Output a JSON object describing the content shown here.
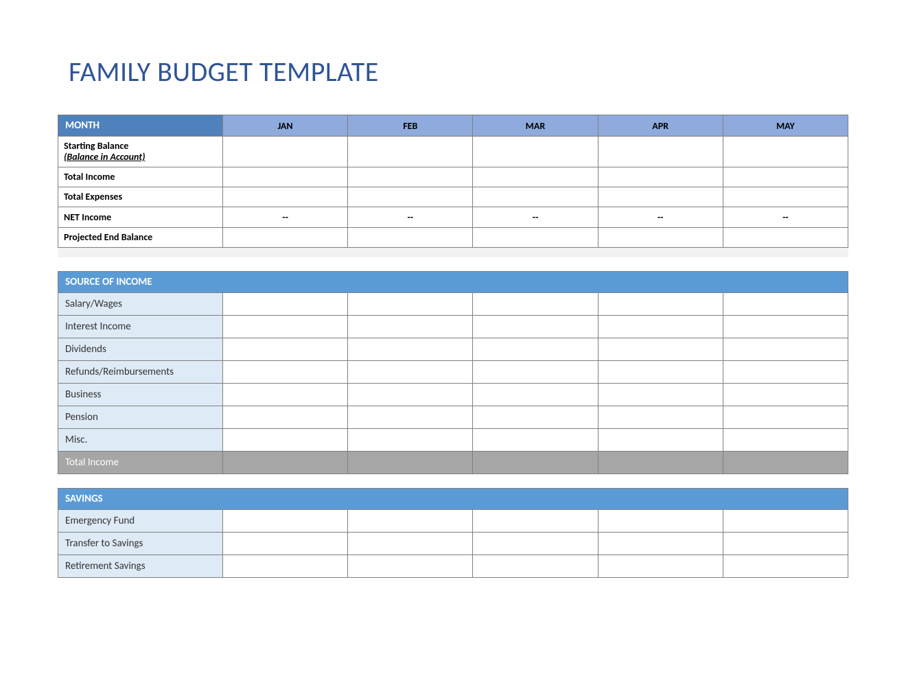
{
  "title": "FAMILY BUDGET TEMPLATE",
  "months": [
    "JAN",
    "FEB",
    "MAR",
    "APR",
    "MAY"
  ],
  "summary": {
    "month_label": "MONTH",
    "rows": [
      {
        "label": "Starting Balance",
        "sublabel": "(Balance in Account)",
        "values": [
          "",
          "",
          "",
          "",
          ""
        ]
      },
      {
        "label": "Total Income",
        "values": [
          "",
          "",
          "",
          "",
          ""
        ]
      },
      {
        "label": "Total Expenses",
        "values": [
          "",
          "",
          "",
          "",
          ""
        ]
      },
      {
        "label": "NET Income",
        "values": [
          "--",
          "--",
          "--",
          "--",
          "--"
        ]
      },
      {
        "label": "Projected End Balance",
        "values": [
          "",
          "",
          "",
          "",
          ""
        ]
      }
    ]
  },
  "income": {
    "header": "SOURCE OF INCOME",
    "rows": [
      {
        "label": "Salary/Wages",
        "values": [
          "",
          "",
          "",
          "",
          ""
        ]
      },
      {
        "label": "Interest Income",
        "values": [
          "",
          "",
          "",
          "",
          ""
        ]
      },
      {
        "label": "Dividends",
        "values": [
          "",
          "",
          "",
          "",
          ""
        ]
      },
      {
        "label": "Refunds/Reimbursements",
        "values": [
          "",
          "",
          "",
          "",
          ""
        ]
      },
      {
        "label": "Business",
        "values": [
          "",
          "",
          "",
          "",
          ""
        ]
      },
      {
        "label": "Pension",
        "values": [
          "",
          "",
          "",
          "",
          ""
        ]
      },
      {
        "label": "Misc.",
        "values": [
          "",
          "",
          "",
          "",
          ""
        ]
      }
    ],
    "total_label": "Total Income",
    "total_values": [
      "",
      "",
      "",
      "",
      ""
    ]
  },
  "savings": {
    "header": "SAVINGS",
    "rows": [
      {
        "label": "Emergency Fund",
        "values": [
          "",
          "",
          "",
          "",
          ""
        ]
      },
      {
        "label": "Transfer to Savings",
        "values": [
          "",
          "",
          "",
          "",
          ""
        ]
      },
      {
        "label": "Retirement Savings",
        "values": [
          "",
          "",
          "",
          "",
          ""
        ]
      }
    ]
  }
}
